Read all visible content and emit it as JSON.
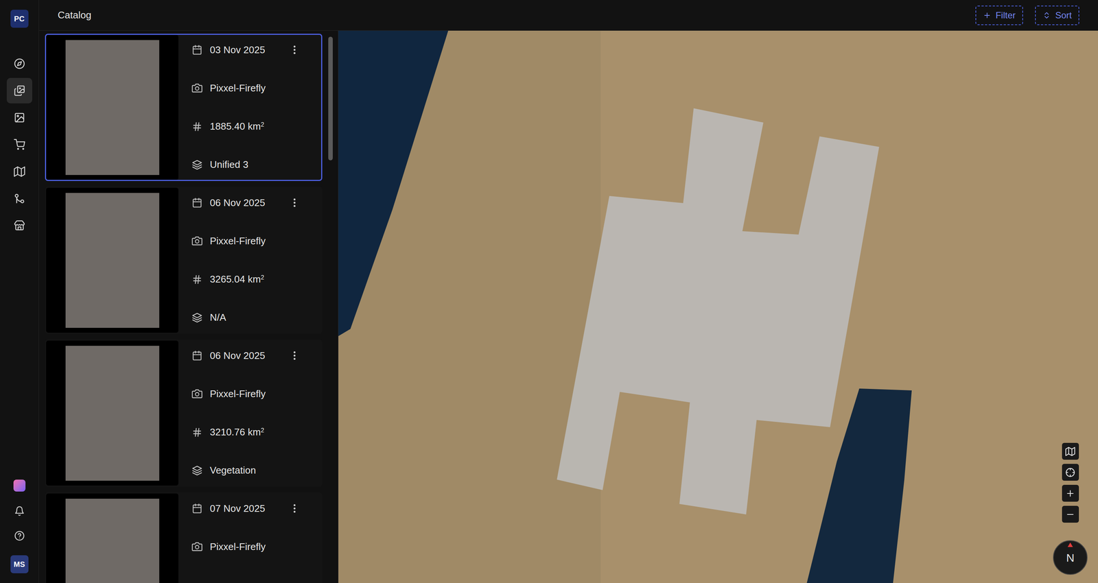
{
  "sidebar": {
    "logo": "PC",
    "user": "MS",
    "items": [
      {
        "name": "explore",
        "selected": false
      },
      {
        "name": "catalog",
        "selected": true
      },
      {
        "name": "image-settings",
        "selected": false
      },
      {
        "name": "cart",
        "selected": false
      },
      {
        "name": "maps",
        "selected": false
      },
      {
        "name": "workflows",
        "selected": false
      },
      {
        "name": "store",
        "selected": false
      }
    ]
  },
  "header": {
    "title": "Catalog",
    "actions": [
      {
        "label": "Filter",
        "kind": "filter"
      },
      {
        "label": "Sort",
        "kind": "sort"
      }
    ]
  },
  "catalog": {
    "cards": [
      {
        "date": "03 Nov 2025",
        "sensor": "Pixxel-Firefly",
        "area": "1885.40 km",
        "area_exponent": "2",
        "product": "Unified 3",
        "selected": true
      },
      {
        "date": "06 Nov 2025",
        "sensor": "Pixxel-Firefly",
        "area": "3265.04 km",
        "area_exponent": "2",
        "product": "N/A",
        "selected": false
      },
      {
        "date": "06 Nov 2025",
        "sensor": "Pixxel-Firefly",
        "area": "3210.76 km",
        "area_exponent": "2",
        "product": "Vegetation",
        "selected": false
      },
      {
        "date": "07 Nov 2025",
        "sensor": "Pixxel-Firefly",
        "selected": false
      }
    ]
  },
  "map": {
    "compass": "N"
  }
}
